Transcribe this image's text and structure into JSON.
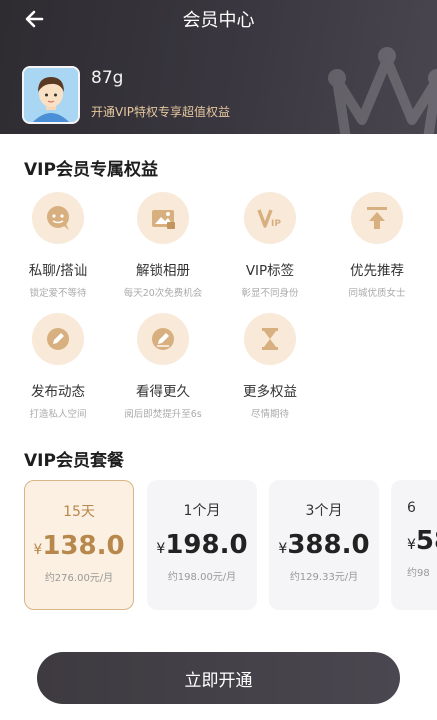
{
  "header": {
    "title": "会员中心",
    "back_icon": "back-arrow-icon"
  },
  "user": {
    "nickname": "87g",
    "promo": "开通VIP特权专享超值权益"
  },
  "benefits_section": {
    "title": "VIP会员专属权益",
    "items": [
      {
        "name": "私聊/搭讪",
        "desc": "锁定爱不等待",
        "icon": "chat-icon"
      },
      {
        "name": "解锁相册",
        "desc": "每天20次免费机会",
        "icon": "album-icon"
      },
      {
        "name": "VIP标签",
        "desc": "彰显不同身份",
        "icon": "vip-tag-icon"
      },
      {
        "name": "优先推荐",
        "desc": "同城优质女士",
        "icon": "top-up-icon"
      },
      {
        "name": "发布动态",
        "desc": "打造私人空间",
        "icon": "edit-icon"
      },
      {
        "name": "看得更久",
        "desc": "阅后即焚提升至6s",
        "icon": "pen-icon"
      },
      {
        "name": "更多权益",
        "desc": "尽情期待",
        "icon": "hourglass-icon"
      }
    ]
  },
  "packages_section": {
    "title": "VIP会员套餐",
    "items": [
      {
        "duration": "15天",
        "currency": "¥",
        "price": "138.0",
        "per_month": "约276.00元/月",
        "selected": true
      },
      {
        "duration": "1个月",
        "currency": "¥",
        "price": "198.0",
        "per_month": "约198.00元/月",
        "selected": false
      },
      {
        "duration": "3个月",
        "currency": "¥",
        "price": "388.0",
        "per_month": "约129.33元/月",
        "selected": false
      },
      {
        "duration": "6",
        "currency": "¥",
        "price": "58",
        "per_month": "约98",
        "selected": false
      }
    ]
  },
  "cta": {
    "label": "立即开通"
  },
  "colors": {
    "header_bg": "#3a3740",
    "accent_gold": "#b8874c",
    "benefit_circle": "#f8e9d9",
    "selected_card_bg": "#fbf0e2"
  }
}
